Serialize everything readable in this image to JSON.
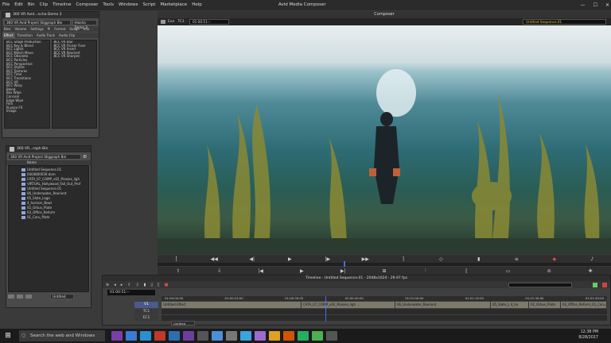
{
  "app": {
    "title": "Avid Media Composer",
    "menu": [
      "File",
      "Edit",
      "Bin",
      "Clip",
      "Timeline",
      "Composer",
      "Tools",
      "Windows",
      "Script",
      "Marketplace",
      "Help"
    ]
  },
  "effects_panel": {
    "title": "360 VR Avid...ncha Demo 2",
    "project": "360 VR Avid Project Sliggraph Ble",
    "project_tab_extra": "Hlasha Demo 2",
    "tabs": [
      "Bins",
      "Volume",
      "Settings",
      "Pi",
      "Format",
      "Usage",
      "Info"
    ],
    "subtabs": [
      "Effect",
      "Transition",
      "Audio Track",
      "Audio Clip"
    ],
    "categories": [
      "BCC Stage Production",
      "BCC Key & Blend",
      "BCC Lights",
      "BCC Match Move",
      "BCC Obsolete",
      "BCC Particles",
      "BCC Perspective",
      "BCC Stylize",
      "BCC Textures",
      "BCC Time",
      "BCC Transitions",
      "BCC VR",
      "BCC Warp",
      "Blend",
      "Box Wipe",
      "Conceal",
      "Edge Wipe",
      "Film",
      "Illusion FX",
      "Image"
    ],
    "effects": [
      "BCC VR Blur",
      "BCC VR Flicker Fixer",
      "BCC VR Insert",
      "BCC VR Reorient",
      "BCC VR Sharpen"
    ]
  },
  "bin_panel": {
    "title": "360 VR...raph Bin",
    "project": "360 VR Avid Project Sliggraph Bin",
    "column_header": "Name",
    "items": [
      "Untitled Sequence.01",
      "0404800039.dom",
      "CATA_07_COMP_v02_Proxies_ligh",
      "VIRTUAL_Hollywood_Fall_Out_Prof",
      "Untitled Sequence.01",
      "06_Underwater_Reorient",
      "05_Slate_Logo",
      "4_horizon_Bowl",
      "02_Orbus_Plate",
      "03_Office_Reform",
      "01_Caru_Plate"
    ],
    "footer_dropdown": "Untitled"
  },
  "composer": {
    "title": "Composer",
    "source_label": "Ean",
    "track_label": "TC1",
    "timecode": "01:00:51:--",
    "sequence": "Untitled Sequence.01"
  },
  "timeline": {
    "title": "Timeline - Untitled Sequence.01 - 2048x1024 - 29.97 fps",
    "position": "01:00:51:--",
    "tracks": [
      "V1",
      "TC1",
      "EC1"
    ],
    "ruler": [
      "01:00:00:00",
      "01:00:15:00",
      "01:00:30:00",
      "01:00:45:00",
      "01:01:00:00",
      "01:01:15:00",
      "01:01:30:00",
      "01:01:45:00"
    ],
    "clips": [
      "Untitled Effect",
      "CATA_07_COMP_v02_Proxies_ligh ...",
      "06_Underwater_Reorient",
      "05_Slate_L 4_ho",
      "02_Orbus_Plate",
      "03_Office_Reform_01_Caru_Plate"
    ],
    "footer_dropdown": "Untitled"
  },
  "taskbar": {
    "search_placeholder": "Search the web and Windows",
    "time": "12:38 PM",
    "date": "8/28/2017",
    "app_colors": [
      "#7a3ea8",
      "#3a7bd5",
      "#2a8fd0",
      "#c0392b",
      "#2d6eb0",
      "#6b3fa0",
      "#555555",
      "#4a90d9",
      "#777777",
      "#3ba3e0",
      "#9a6bd1",
      "#e0a020",
      "#d35400",
      "#27ae60",
      "#4caf50",
      "#555555"
    ]
  }
}
